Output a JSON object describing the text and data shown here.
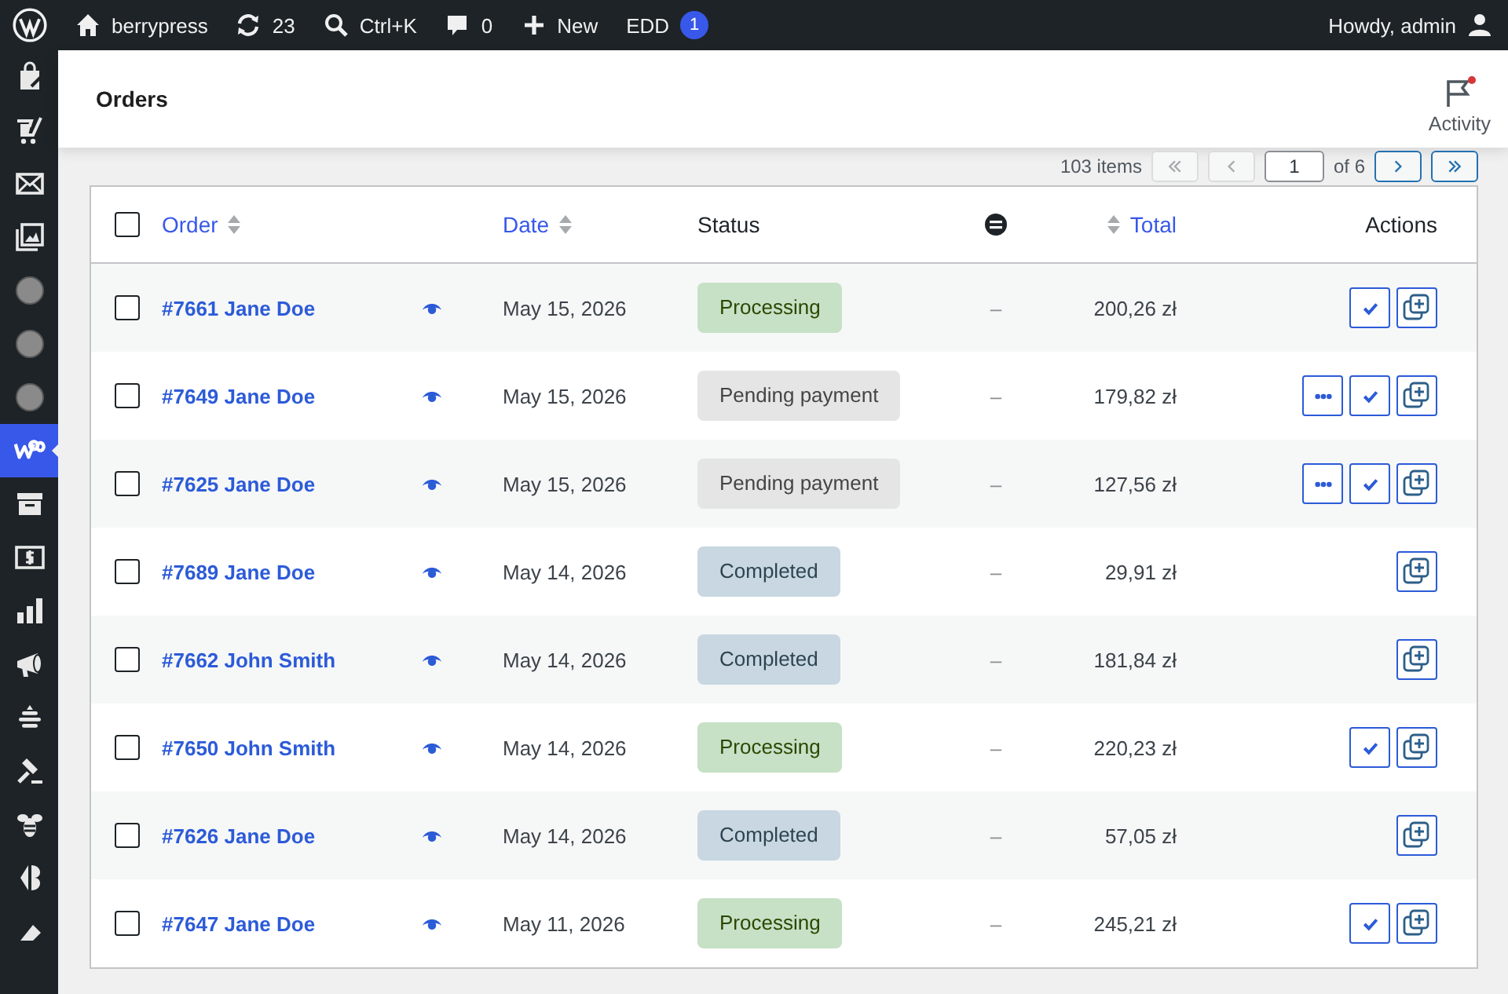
{
  "admin_bar": {
    "site": "berrypress",
    "updates": "23",
    "search": "Ctrl+K",
    "comments": "0",
    "new": "New",
    "edd": "EDD",
    "edd_count": "1",
    "greeting": "Howdy, admin"
  },
  "sidebar": {
    "items": [
      {
        "kind": "bag",
        "selected": false
      },
      {
        "kind": "cart",
        "selected": false
      },
      {
        "kind": "mail",
        "selected": false
      },
      {
        "kind": "images",
        "selected": false
      },
      {
        "kind": "circle",
        "selected": false
      },
      {
        "kind": "circle",
        "selected": false
      },
      {
        "kind": "circle",
        "selected": false
      },
      {
        "kind": "woo",
        "selected": true
      },
      {
        "kind": "archive",
        "selected": false
      },
      {
        "kind": "dollar",
        "selected": false
      },
      {
        "kind": "chart",
        "selected": false
      },
      {
        "kind": "megaphone",
        "selected": false
      },
      {
        "kind": "hive",
        "selected": false
      },
      {
        "kind": "hammer",
        "selected": false
      },
      {
        "kind": "bee",
        "selected": false
      },
      {
        "kind": "plugin",
        "selected": false
      },
      {
        "kind": "brush",
        "selected": false
      }
    ]
  },
  "header": {
    "title": "Orders",
    "activity": "Activity",
    "activity_alert": true
  },
  "pagination": {
    "items": "103 items",
    "page": "1",
    "of": "of 6"
  },
  "table": {
    "columns": [
      "Order",
      "Date",
      "Status",
      "Total",
      "Actions"
    ],
    "select_all_checked": false,
    "rows": [
      {
        "checked": false,
        "order": "#7661 Jane Doe",
        "date": "May 15, 2026",
        "status": {
          "label": "Processing",
          "kind": "processing"
        },
        "sync": "–",
        "total": "200,26 zł",
        "actions": [
          {
            "kind": "complete"
          },
          {
            "kind": "duplicate"
          }
        ]
      },
      {
        "checked": false,
        "order": "#7649 Jane Doe",
        "date": "May 15, 2026",
        "status": {
          "label": "Pending payment",
          "kind": "pending"
        },
        "sync": "–",
        "total": "179,82 zł",
        "actions": [
          {
            "kind": "more"
          },
          {
            "kind": "complete"
          },
          {
            "kind": "duplicate"
          }
        ]
      },
      {
        "checked": false,
        "order": "#7625 Jane Doe",
        "date": "May 15, 2026",
        "status": {
          "label": "Pending payment",
          "kind": "pending"
        },
        "sync": "–",
        "total": "127,56 zł",
        "actions": [
          {
            "kind": "more"
          },
          {
            "kind": "complete"
          },
          {
            "kind": "duplicate"
          }
        ]
      },
      {
        "checked": false,
        "order": "#7689 Jane Doe",
        "date": "May 14, 2026",
        "status": {
          "label": "Completed",
          "kind": "completed"
        },
        "sync": "–",
        "total": "29,91 zł",
        "actions": [
          {
            "kind": "duplicate"
          }
        ]
      },
      {
        "checked": false,
        "order": "#7662 John Smith",
        "date": "May 14, 2026",
        "status": {
          "label": "Completed",
          "kind": "completed"
        },
        "sync": "–",
        "total": "181,84 zł",
        "actions": [
          {
            "kind": "duplicate"
          }
        ]
      },
      {
        "checked": false,
        "order": "#7650 John Smith",
        "date": "May 14, 2026",
        "status": {
          "label": "Processing",
          "kind": "processing"
        },
        "sync": "–",
        "total": "220,23 zł",
        "actions": [
          {
            "kind": "complete"
          },
          {
            "kind": "duplicate"
          }
        ]
      },
      {
        "checked": false,
        "order": "#7626 Jane Doe",
        "date": "May 14, 2026",
        "status": {
          "label": "Completed",
          "kind": "completed"
        },
        "sync": "–",
        "total": "57,05 zł",
        "actions": [
          {
            "kind": "duplicate"
          }
        ]
      },
      {
        "checked": false,
        "order": "#7647 Jane Doe",
        "date": "May 11, 2026",
        "status": {
          "label": "Processing",
          "kind": "processing"
        },
        "sync": "–",
        "total": "245,21 zł",
        "actions": [
          {
            "kind": "complete"
          },
          {
            "kind": "duplicate"
          }
        ]
      }
    ]
  }
}
